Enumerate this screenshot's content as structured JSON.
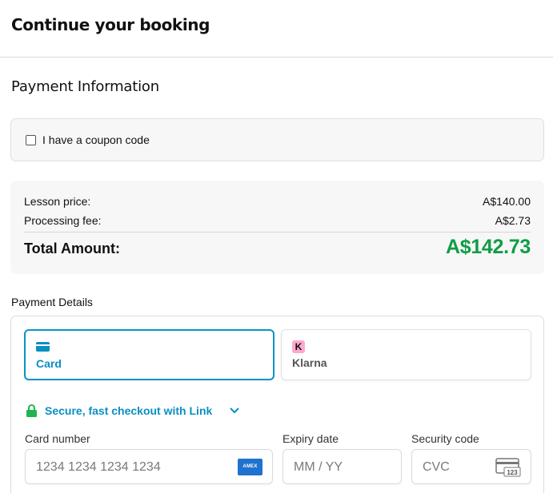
{
  "header": {
    "title": "Continue your booking"
  },
  "payment_info": {
    "title": "Payment Information"
  },
  "coupon": {
    "label": "I have a coupon code",
    "checked": false
  },
  "summary": {
    "lesson_label": "Lesson price:",
    "lesson_value": "A$140.00",
    "fee_label": "Processing fee:",
    "fee_value": "A$2.73",
    "total_label": "Total Amount:",
    "total_value": "A$142.73",
    "total_color": "#0f9d45"
  },
  "details": {
    "title": "Payment Details",
    "tabs": [
      {
        "label": "Card",
        "icon": "card-icon",
        "selected": true
      },
      {
        "label": "Klarna",
        "icon": "klarna-icon",
        "icon_text": "K",
        "selected": false
      }
    ],
    "link_text": "Secure, fast checkout with Link",
    "accent_color": "#0a8fc2",
    "fields": {
      "card_number": {
        "label": "Card number",
        "placeholder": "1234 1234 1234 1234",
        "value": "",
        "brand": "AMEX"
      },
      "expiry": {
        "label": "Expiry date",
        "placeholder": "MM / YY",
        "value": ""
      },
      "cvc": {
        "label": "Security code",
        "placeholder": "CVC",
        "value": "",
        "icon_text": "123"
      }
    }
  }
}
